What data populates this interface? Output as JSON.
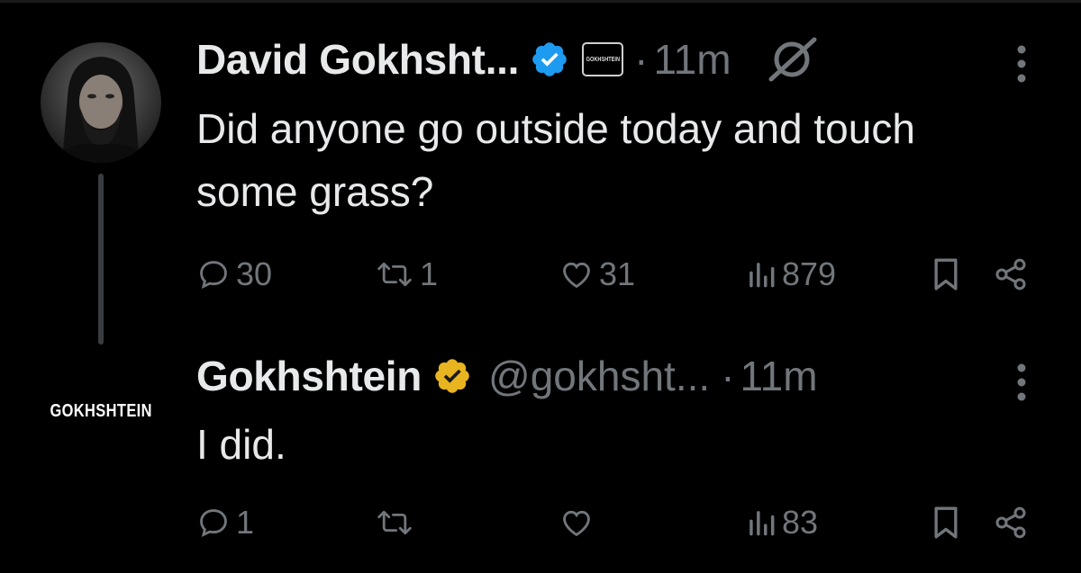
{
  "tweets": [
    {
      "name": "David Gokhsht...",
      "badge_text": "GOKHSHTEIN",
      "dot": "·",
      "time": "11m",
      "text": "Did anyone go outside today and touch some grass?",
      "replies": "30",
      "reposts": "1",
      "likes": "31",
      "views": "879",
      "verified_color": "#1d9bf0"
    },
    {
      "name": "Gokhshtein",
      "handle": "@gokhsht...",
      "dot": "·",
      "time": "11m",
      "text": "I did.",
      "avatar_text": "GOKHSHTEIN",
      "replies": "1",
      "reposts": "",
      "likes": "",
      "views": "83",
      "verified_color": "#e8b41f"
    }
  ],
  "icons": [
    "verified-badge-icon",
    "grok-icon",
    "more-icon",
    "reply-icon",
    "repost-icon",
    "like-icon",
    "views-icon",
    "bookmark-icon",
    "share-icon"
  ]
}
